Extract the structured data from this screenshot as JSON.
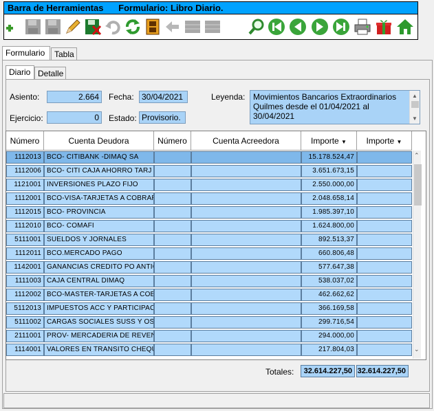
{
  "titlebar": {
    "left": "Barra de Herramientas",
    "right": "Formulario: Libro Diario."
  },
  "toolbar": {
    "icons": [
      "add-icon",
      "save-disabled-icon",
      "save-disabled-icon",
      "pencil-icon",
      "save-cancel-icon",
      "undo-disabled-icon",
      "refresh-icon",
      "film-icon",
      "back-arrow-disabled-icon",
      "grid-disabled-icon",
      "grid-disabled-icon",
      "magnifier-icon",
      "first-icon",
      "prev-icon",
      "next-icon",
      "last-icon",
      "printer-icon",
      "gift-icon",
      "home-icon"
    ]
  },
  "tabs_outer": [
    "Formulario",
    "Tabla"
  ],
  "tabs_inner": [
    "Diario",
    "Detalle"
  ],
  "form": {
    "asiento_label": "Asiento:",
    "asiento_value": "2.664",
    "fecha_label": "Fecha:",
    "fecha_value": "30/04/2021",
    "leyenda_label": "Leyenda:",
    "leyenda_value": "Movimientos Bancarios Extraordinarios Quilmes desde el 01/04/2021 al 30/04/2021",
    "ejercicio_label": "Ejercicio:",
    "ejercicio_value": "0",
    "estado_label": "Estado:",
    "estado_value": "Provisorio."
  },
  "grid": {
    "headers": [
      "Número",
      "Cuenta Deudora",
      "Número",
      "Cuenta Acreedora",
      "Importe",
      "Importe"
    ],
    "rows": [
      [
        "1112013",
        "BCO- CITIBANK -DIMAQ SA",
        "",
        "",
        "15.178.524,47",
        ""
      ],
      [
        "1112006",
        "BCO- CITI CAJA AHORRO TARJ",
        "",
        "",
        "3.651.673,15",
        ""
      ],
      [
        "1121001",
        "INVERSIONES PLAZO FIJO",
        "",
        "",
        "2.550.000,00",
        ""
      ],
      [
        "1112001",
        "BCO-VISA-TARJETAS A COBRAR",
        "",
        "",
        "2.048.658,14",
        ""
      ],
      [
        "1112015",
        "BCO- PROVINCIA",
        "",
        "",
        "1.985.397,10",
        ""
      ],
      [
        "1112010",
        "BCO- COMAFI",
        "",
        "",
        "1.624.800,00",
        ""
      ],
      [
        "5111001",
        "SUELDOS Y JORNALES",
        "",
        "",
        "892.513,37",
        ""
      ],
      [
        "1112011",
        "BCO.MERCADO PAGO",
        "",
        "",
        "660.806,48",
        ""
      ],
      [
        "1142001",
        "GANANCIAS CREDITO PO ANTIC",
        "",
        "",
        "577.647,38",
        ""
      ],
      [
        "1111003",
        "CAJA CENTRAL DIMAQ",
        "",
        "",
        "538.037,02",
        ""
      ],
      [
        "1112002",
        "BCO-MASTER-TARJETAS A COBR",
        "",
        "",
        "462.662,62",
        ""
      ],
      [
        "5112013",
        "IMPUESTOS ACC Y PARTICIPAC",
        "",
        "",
        "366.169,58",
        ""
      ],
      [
        "5111002",
        "CARGAS SOCIALES SUSS Y OS",
        "",
        "",
        "299.716,54",
        ""
      ],
      [
        "2111001",
        "PROV- MERCADERIA DE REVENTA",
        "",
        "",
        "294.000,00",
        ""
      ],
      [
        "1114001",
        "VALORES EN TRANSITO CHEQUES",
        "",
        "",
        "217.804,03",
        ""
      ]
    ]
  },
  "totals": {
    "label": "Totales:",
    "debe": "32.614.227,50",
    "haber": "32.614.227,50"
  }
}
